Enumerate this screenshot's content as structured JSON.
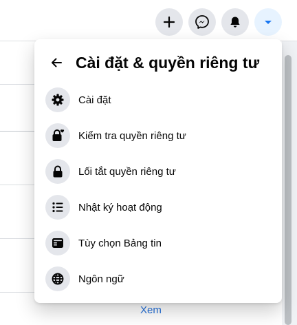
{
  "topbar": {
    "buttons": [
      {
        "icon": "plus-icon"
      },
      {
        "icon": "messenger-icon"
      },
      {
        "icon": "bell-icon"
      },
      {
        "icon": "caret-down-icon",
        "active": true
      }
    ]
  },
  "panel": {
    "title": "Cài đặt & quyền riêng tư",
    "items": [
      {
        "label": "Cài đặt",
        "icon": "gear-icon"
      },
      {
        "label": "Kiểm tra quyền riêng tư",
        "icon": "lock-heart-icon"
      },
      {
        "label": "Lối tắt quyền riêng tư",
        "icon": "lock-icon"
      },
      {
        "label": "Nhật ký hoạt động",
        "icon": "list-icon"
      },
      {
        "label": "Tùy chọn Bảng tin",
        "icon": "news-feed-icon"
      },
      {
        "label": "Ngôn ngữ",
        "icon": "globe-icon"
      }
    ]
  },
  "background": {
    "link_label": "Xem"
  },
  "colors": {
    "accent": "#1877f2",
    "icon_bg": "#e4e6eb",
    "link": "#216fdb"
  }
}
